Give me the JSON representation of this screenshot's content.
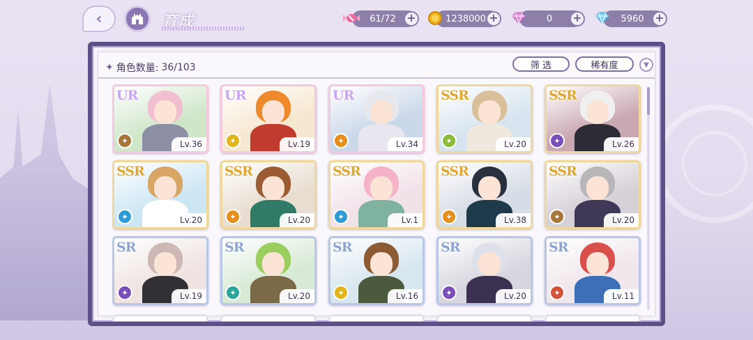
{
  "header": {
    "title": "育成",
    "resources": [
      {
        "icon": "candy-icon",
        "value": "61/72"
      },
      {
        "icon": "coin-icon",
        "value": "1238000"
      },
      {
        "icon": "pink-diamond-icon",
        "value": "0"
      },
      {
        "icon": "blue-diamond-icon",
        "value": "5960"
      }
    ]
  },
  "panel": {
    "count_label": "角色数量:",
    "count_value": "36/103",
    "filter_label": "筛 选",
    "sort_label": "稀有度"
  },
  "cards": [
    {
      "rarity": "UR",
      "level": "Lv.36",
      "attr": "brown",
      "hair": "#f1bfcf",
      "bg": "#cfe6c9",
      "outfit": "#8c8fa6"
    },
    {
      "rarity": "UR",
      "level": "Lv.19",
      "attr": "yellow",
      "hair": "#ef8a2c",
      "bg": "#f6e7d0",
      "outfit": "#c23b2f"
    },
    {
      "rarity": "UR",
      "level": "Lv.34",
      "attr": "orange",
      "hair": "#e6e8ee",
      "bg": "#cbd8ea",
      "outfit": "#e9e6ef"
    },
    {
      "rarity": "SSR",
      "level": "Lv.20",
      "attr": "green",
      "hair": "#d9bf9a",
      "bg": "#d7e4ef",
      "outfit": "#efe8de"
    },
    {
      "rarity": "SSR",
      "level": "Lv.26",
      "attr": "purple",
      "hair": "#f0f0f2",
      "bg": "#caa8b2",
      "outfit": "#2d2b36"
    },
    {
      "rarity": "SSR",
      "level": "Lv.20",
      "attr": "blue",
      "hair": "#d8a564",
      "bg": "#cde6f3",
      "outfit": "#ffffff"
    },
    {
      "rarity": "SSR",
      "level": "Lv.20",
      "attr": "orange",
      "hair": "#9b5b33",
      "bg": "#e8ddd0",
      "outfit": "#2f7b67"
    },
    {
      "rarity": "SSR",
      "level": "Lv.1",
      "attr": "blue",
      "hair": "#f4b3c7",
      "bg": "#f1e2ea",
      "outfit": "#7fb3a0"
    },
    {
      "rarity": "SSR",
      "level": "Lv.38",
      "attr": "orange",
      "hair": "#29313e",
      "bg": "#d7dde6",
      "outfit": "#1f3a4a"
    },
    {
      "rarity": "SSR",
      "level": "Lv.20",
      "attr": "brown",
      "hair": "#b8b6b8",
      "bg": "#d6d0d8",
      "outfit": "#3f3856"
    },
    {
      "rarity": "SR",
      "level": "Lv.19",
      "attr": "purple",
      "hair": "#cdb8b6",
      "bg": "#efe4e1",
      "outfit": "#333035"
    },
    {
      "rarity": "SR",
      "level": "Lv.20",
      "attr": "teal",
      "hair": "#9bcd5f",
      "bg": "#d8ead6",
      "outfit": "#7a6a47"
    },
    {
      "rarity": "SR",
      "level": "Lv.16",
      "attr": "yellow",
      "hair": "#8c5a33",
      "bg": "#d7e6ef",
      "outfit": "#4b5a3d"
    },
    {
      "rarity": "SR",
      "level": "Lv.20",
      "attr": "purple",
      "hair": "#dfe1ea",
      "bg": "#d8d6df",
      "outfit": "#3b3050"
    },
    {
      "rarity": "SR",
      "level": "Lv.11",
      "attr": "red",
      "hair": "#d94f4c",
      "bg": "#f0e6ec",
      "outfit": "#3d6fb8"
    }
  ]
}
